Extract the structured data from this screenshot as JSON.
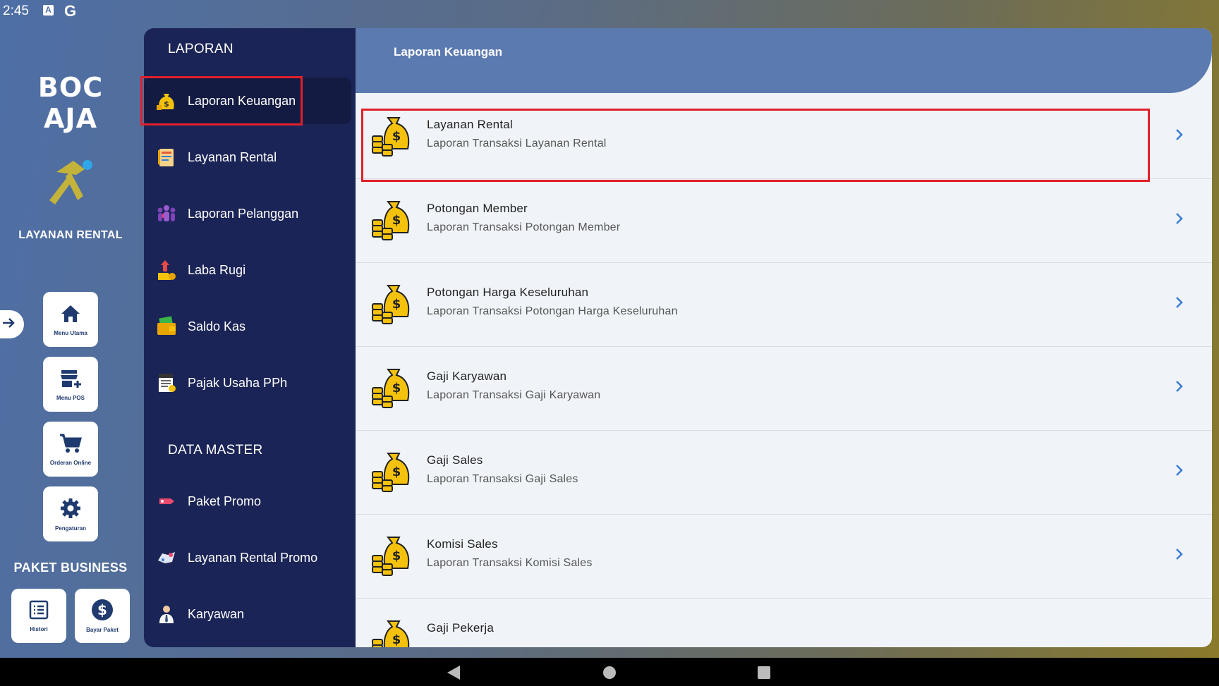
{
  "status_bar": {
    "time": "2:45",
    "icon_a": "A",
    "icon_g": "G"
  },
  "rail": {
    "logo_text": "BOC AJA",
    "app_name": "LAYANAN RENTAL",
    "buttons": [
      {
        "label": "Menu Utama",
        "icon": "home-icon"
      },
      {
        "label": "Menu POS",
        "icon": "store-icon"
      },
      {
        "label": "Orderan Online",
        "icon": "cart-icon"
      },
      {
        "label": "Pengaturan",
        "icon": "gear-icon"
      }
    ],
    "paket_title": "PAKET BUSINESS",
    "paket_buttons": [
      {
        "label": "Histori",
        "icon": "list-icon"
      },
      {
        "label": "Bayar Paket",
        "icon": "dollar-icon"
      }
    ]
  },
  "menu": {
    "section_laporan": "LAPORAN",
    "laporan_items": [
      {
        "label": "Laporan Keuangan",
        "icon": "money-bag-icon",
        "active": true
      },
      {
        "label": "Layanan Rental",
        "icon": "document-icon"
      },
      {
        "label": "Laporan Pelanggan",
        "icon": "people-icon"
      },
      {
        "label": "Laba Rugi",
        "icon": "profit-icon"
      },
      {
        "label": "Saldo Kas",
        "icon": "wallet-icon"
      },
      {
        "label": "Pajak Usaha PPh",
        "icon": "tax-icon"
      }
    ],
    "section_master": "DATA MASTER",
    "master_items": [
      {
        "label": "Paket Promo",
        "icon": "promo-tag-icon"
      },
      {
        "label": "Layanan Rental Promo",
        "icon": "promo-icon"
      },
      {
        "label": "Karyawan",
        "icon": "employee-icon"
      }
    ]
  },
  "content": {
    "header_title": "Laporan Keuangan",
    "rows": [
      {
        "title": "Layanan Rental",
        "subtitle": "Laporan Transaksi Layanan Rental"
      },
      {
        "title": "Potongan Member",
        "subtitle": "Laporan Transaksi Potongan Member"
      },
      {
        "title": "Potongan Harga Keseluruhan",
        "subtitle": "Laporan Transaksi Potongan Harga Keseluruhan"
      },
      {
        "title": "Gaji Karyawan",
        "subtitle": "Laporan Transaksi Gaji Karyawan"
      },
      {
        "title": "Gaji Sales",
        "subtitle": "Laporan Transaksi Gaji Sales"
      },
      {
        "title": "Komisi Sales",
        "subtitle": "Laporan Transaksi Komisi Sales"
      },
      {
        "title": "Gaji Pekerja",
        "subtitle": ""
      }
    ]
  },
  "colors": {
    "menu_bg": "#1b2456",
    "header_bg": "#5b7ab0",
    "highlight": "#e0202a",
    "chevron": "#3a7bd5"
  }
}
